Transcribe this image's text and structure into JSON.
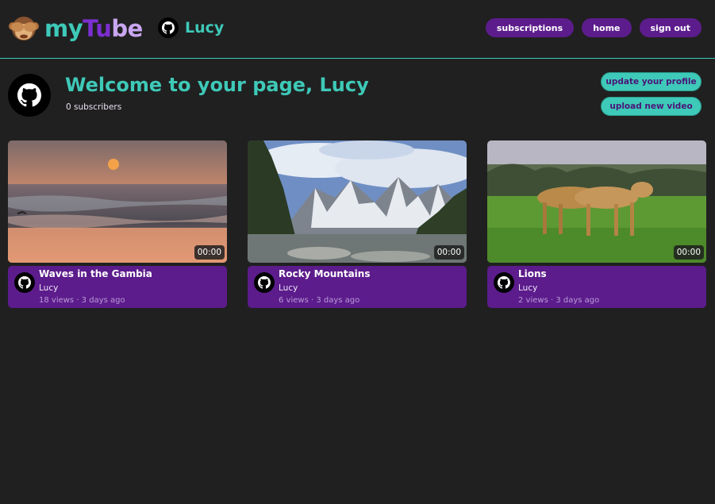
{
  "app": {
    "logo": {
      "part1": "my",
      "part2": "Tu",
      "part3": "be"
    },
    "username": "Lucy"
  },
  "nav": {
    "subscriptions": "subscriptions",
    "home": "home",
    "sign_out": "sign out"
  },
  "profile": {
    "welcome": "Welcome to your page, Lucy",
    "subscribers": "0 subscribers",
    "update_profile": "update your profile",
    "upload_video": "upload new video"
  },
  "videos": [
    {
      "title": "Waves in the Gambia",
      "author": "Lucy",
      "meta": "18 views · 3 days ago",
      "duration": "00:00"
    },
    {
      "title": "Rocky Mountains",
      "author": "Lucy",
      "meta": "6 views · 3 days ago",
      "duration": "00:00"
    },
    {
      "title": "Lions",
      "author": "Lucy",
      "meta": "2 views · 3 days ago",
      "duration": "00:00"
    }
  ],
  "icons": {
    "logo": "see-no-evil-monkey-icon",
    "avatar": "github-icon"
  },
  "colors": {
    "accent": "#3ec9b8",
    "purple": "#5c1c8c",
    "background": "#202020"
  }
}
